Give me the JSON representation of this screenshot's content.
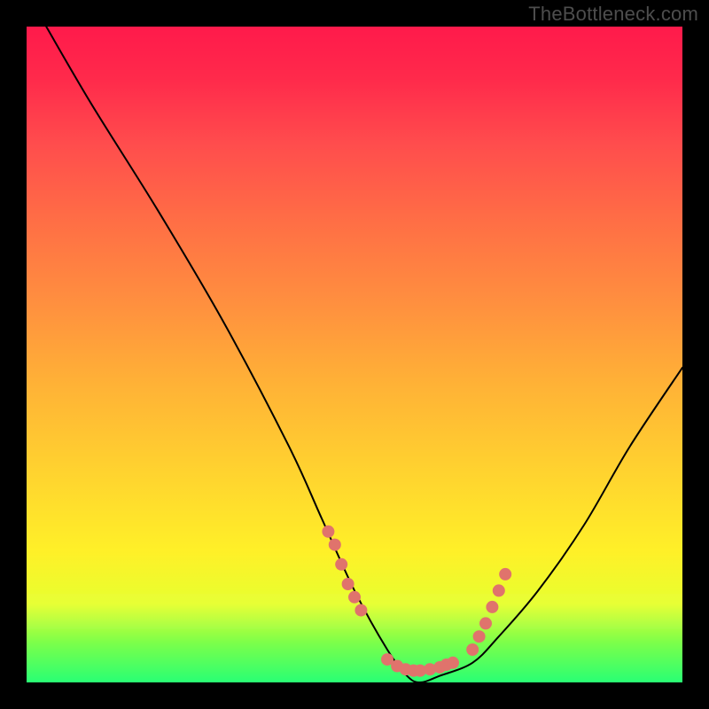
{
  "watermark": "TheBottleneck.com",
  "chart_data": {
    "type": "line",
    "title": "",
    "xlabel": "",
    "ylabel": "",
    "xlim": [
      0,
      100
    ],
    "ylim": [
      0,
      100
    ],
    "grid": false,
    "series": [
      {
        "name": "bottleneck-curve",
        "x": [
          3,
          10,
          20,
          30,
          40,
          45,
          50,
          55,
          58,
          60,
          63,
          68,
          72,
          78,
          85,
          92,
          100
        ],
        "values": [
          100,
          88,
          72,
          55,
          36,
          25,
          14,
          5,
          1,
          0,
          1,
          3,
          7,
          14,
          24,
          36,
          48
        ]
      }
    ],
    "highlight_points": {
      "name": "highlighted-region",
      "color": "#e0736c",
      "left_branch": [
        {
          "x": 46.0,
          "y": 23.0
        },
        {
          "x": 47.0,
          "y": 21.0
        },
        {
          "x": 48.0,
          "y": 18.0
        },
        {
          "x": 49.0,
          "y": 15.0
        },
        {
          "x": 50.0,
          "y": 13.0
        },
        {
          "x": 51.0,
          "y": 11.0
        }
      ],
      "bottom": [
        {
          "x": 55.0,
          "y": 3.5
        },
        {
          "x": 56.5,
          "y": 2.5
        },
        {
          "x": 57.8,
          "y": 2.0
        },
        {
          "x": 59.0,
          "y": 1.8
        },
        {
          "x": 60.0,
          "y": 1.8
        },
        {
          "x": 61.5,
          "y": 2.0
        },
        {
          "x": 63.0,
          "y": 2.3
        },
        {
          "x": 64.0,
          "y": 2.7
        },
        {
          "x": 65.0,
          "y": 3.0
        }
      ],
      "right_branch": [
        {
          "x": 68.0,
          "y": 5.0
        },
        {
          "x": 69.0,
          "y": 7.0
        },
        {
          "x": 70.0,
          "y": 9.0
        },
        {
          "x": 71.0,
          "y": 11.5
        },
        {
          "x": 72.0,
          "y": 14.0
        },
        {
          "x": 73.0,
          "y": 16.5
        }
      ]
    },
    "gradient_colors": {
      "top": "#ff1a4b",
      "mid": "#ffd32f",
      "bottom": "#29ff74"
    }
  }
}
